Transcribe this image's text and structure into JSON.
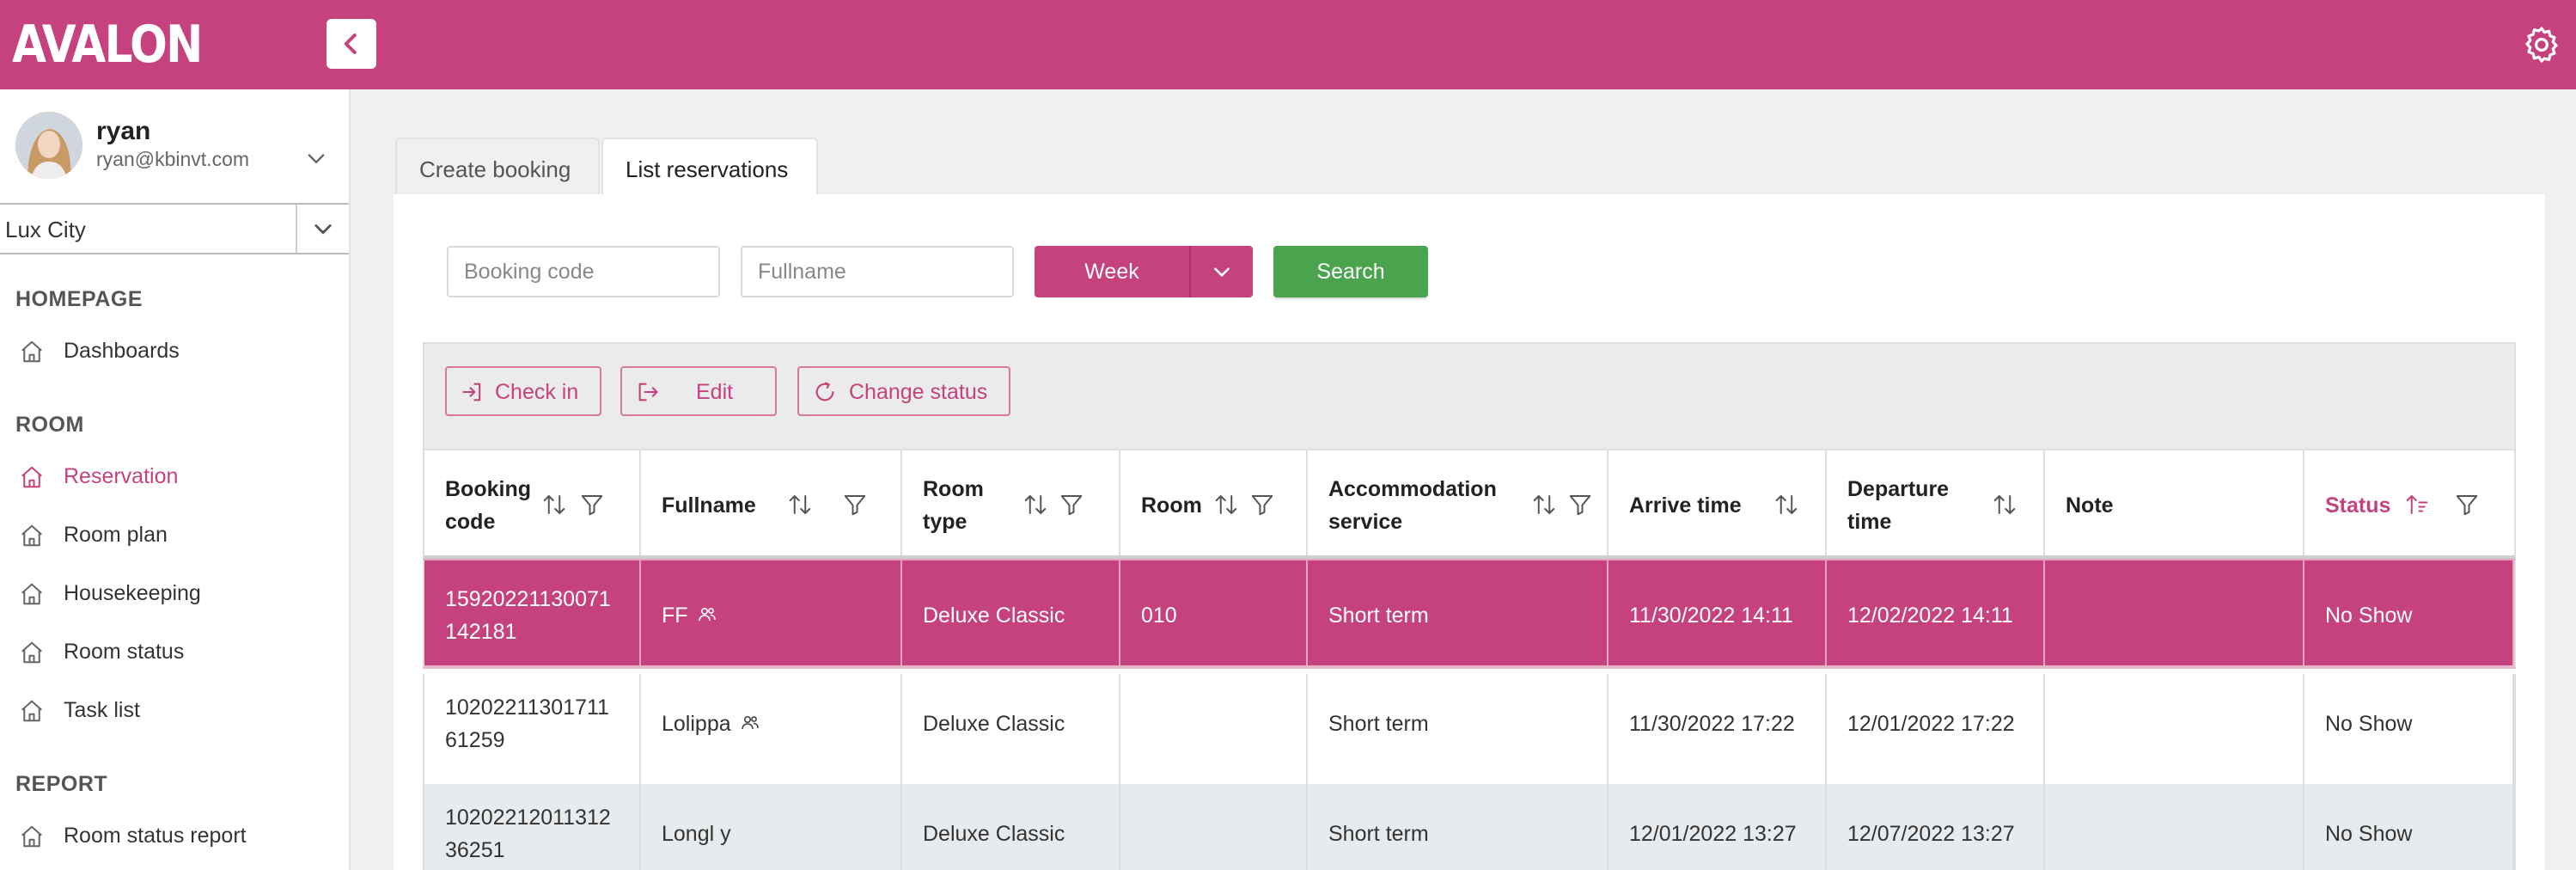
{
  "app": {
    "logo": "AVALON"
  },
  "user": {
    "name": "ryan",
    "email": "ryan@kbinvt.com"
  },
  "hotel": {
    "selected": "Lux City"
  },
  "nav": {
    "sections": [
      {
        "title": "HOMEPAGE",
        "items": [
          {
            "label": "Dashboards",
            "icon": "home-icon",
            "active": false
          }
        ]
      },
      {
        "title": "ROOM",
        "items": [
          {
            "label": "Reservation",
            "icon": "home-icon",
            "active": true
          },
          {
            "label": "Room plan",
            "icon": "home-icon",
            "active": false
          },
          {
            "label": "Housekeeping",
            "icon": "home-icon",
            "active": false
          },
          {
            "label": "Room status",
            "icon": "home-icon",
            "active": false
          },
          {
            "label": "Task list",
            "icon": "home-icon",
            "active": false
          }
        ]
      },
      {
        "title": "REPORT",
        "items": [
          {
            "label": "Room status report",
            "icon": "home-icon",
            "active": false
          }
        ]
      }
    ]
  },
  "tabs": [
    {
      "label": "Create booking",
      "active": false
    },
    {
      "label": "List reservations",
      "active": true
    }
  ],
  "filters": {
    "booking_code": {
      "placeholder": "Booking code",
      "value": ""
    },
    "fullname": {
      "placeholder": "Fullname",
      "value": ""
    },
    "period": "Week",
    "search_label": "Search"
  },
  "toolbar": {
    "check_in": "Check in",
    "edit": "Edit",
    "change_status": "Change status"
  },
  "table": {
    "columns": [
      {
        "label": "Booking code",
        "sort": true,
        "filter": true
      },
      {
        "label": "Fullname",
        "sort": true,
        "filter": true
      },
      {
        "label": "Room type",
        "sort": true,
        "filter": true
      },
      {
        "label": "Room",
        "sort": true,
        "filter": true
      },
      {
        "label": "Accommodation service",
        "sort": true,
        "filter": true
      },
      {
        "label": "Arrive time",
        "sort": true,
        "filter": false
      },
      {
        "label": "Departure time",
        "sort": true,
        "filter": false
      },
      {
        "label": "Note",
        "sort": false,
        "filter": false
      },
      {
        "label": "Status",
        "sort": true,
        "filter": true,
        "active_sort": true
      }
    ],
    "rows": [
      {
        "code": "15920221130071142181",
        "code_line1": "15920221130071",
        "code_line2": "142181",
        "fullname": "FF",
        "group": true,
        "room_type": "Deluxe Classic",
        "room": "010",
        "service": "Short term",
        "arrive": "11/30/2022 14:11",
        "departure": "12/02/2022 14:11",
        "note": "",
        "status": "No Show",
        "selected": true
      },
      {
        "code": "1020221130171161259",
        "code_line1": "10202211301711",
        "code_line2": "61259",
        "fullname": "Lolippa",
        "group": true,
        "room_type": "Deluxe Classic",
        "room": "",
        "service": "Short term",
        "arrive": "11/30/2022 17:22",
        "departure": "12/01/2022 17:22",
        "note": "",
        "status": "No Show",
        "selected": false
      },
      {
        "code": "1020221201131236251",
        "code_line1": "10202212011312",
        "code_line2": "36251",
        "fullname": "Longl y",
        "group": false,
        "room_type": "Deluxe Classic",
        "room": "",
        "service": "Short term",
        "arrive": "12/01/2022 13:27",
        "departure": "12/07/2022 13:27",
        "note": "",
        "status": "No Show",
        "selected": false
      }
    ]
  },
  "colors": {
    "brand": "#c5427f",
    "search": "#4aa34d"
  }
}
